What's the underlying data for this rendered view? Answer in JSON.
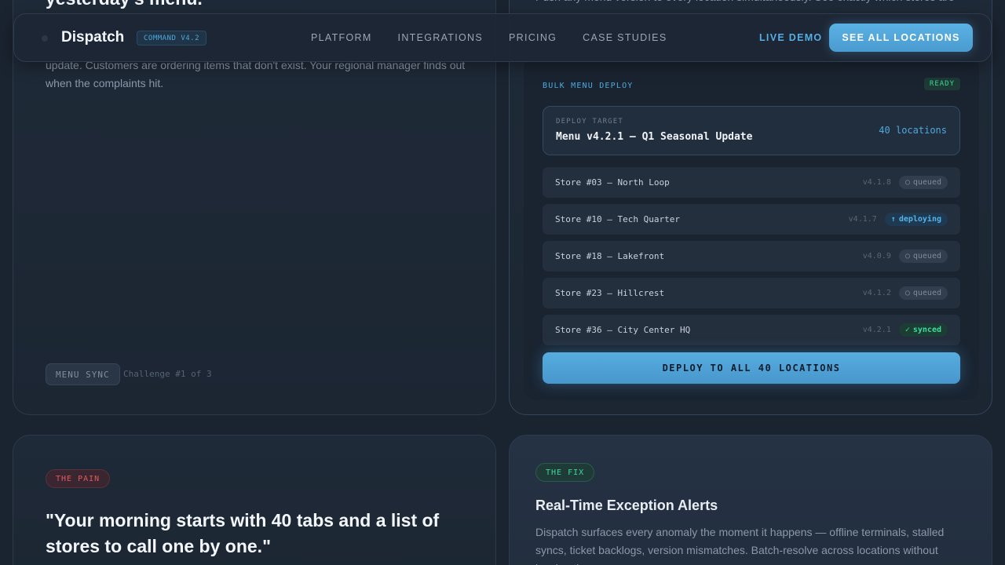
{
  "nav": {
    "brand": "Dispatch",
    "version": "COMMAND V4.2",
    "links": [
      "PLATFORM",
      "INTEGRATIONS",
      "PRICING",
      "CASE STUDIES"
    ],
    "live_demo": "LIVE DEMO",
    "cta": "SEE ALL LOCATIONS"
  },
  "challenge_card": {
    "title_partial": "yesterday's menu.\"",
    "body": "update. Customers are ordering items that don't exist. Your regional manager finds out when the complaints hit.",
    "tag": "MENU SYNC",
    "counter": "Challenge #1 of 3"
  },
  "solution_card": {
    "body_partial": "Push any menu version to every location simultaneously. See exactly which stores are"
  },
  "deploy_panel": {
    "title": "BULK MENU DEPLOY",
    "status": "READY",
    "target_label": "DEPLOY TARGET",
    "target_value": "Menu v4.2.1 — Q1 Seasonal Update",
    "target_count": "40 locations",
    "stores": [
      {
        "name": "Store #03 — North Loop",
        "version": "v4.1.8",
        "icon": "○",
        "status": "queued"
      },
      {
        "name": "Store #10 — Tech Quarter",
        "version": "v4.1.7",
        "icon": "↑",
        "status": "deploying"
      },
      {
        "name": "Store #18 — Lakefront",
        "version": "v4.0.9",
        "icon": "○",
        "status": "queued"
      },
      {
        "name": "Store #23 — Hillcrest",
        "version": "v4.1.2",
        "icon": "○",
        "status": "queued"
      },
      {
        "name": "Store #36 — City Center HQ",
        "version": "v4.2.1",
        "icon": "✓",
        "status": "synced"
      }
    ],
    "button": "DEPLOY TO ALL 40 LOCATIONS"
  },
  "pain_card": {
    "tag": "THE PAIN",
    "quote": "\"Your morning starts with 40 tabs and a list of stores to call one by one.\""
  },
  "fix_card": {
    "tag": "THE FIX",
    "title": "Real-Time Exception Alerts",
    "body": "Dispatch surfaces every anomaly the moment it happens — offline terminals, stalled syncs, ticket backlogs, version mismatches. Batch-resolve across locations without leaving the page."
  },
  "colors": {
    "accent": "#4fa8dc",
    "success": "#3fdc9e",
    "danger": "#e05b5b",
    "background": "#1a2330"
  }
}
